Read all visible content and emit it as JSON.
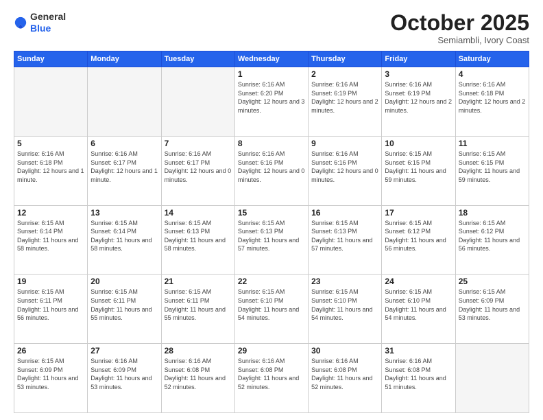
{
  "header": {
    "logo_line1": "General",
    "logo_line2": "Blue",
    "month": "October 2025",
    "location": "Semiambli, Ivory Coast"
  },
  "weekdays": [
    "Sunday",
    "Monday",
    "Tuesday",
    "Wednesday",
    "Thursday",
    "Friday",
    "Saturday"
  ],
  "weeks": [
    [
      {
        "day": "",
        "info": ""
      },
      {
        "day": "",
        "info": ""
      },
      {
        "day": "",
        "info": ""
      },
      {
        "day": "1",
        "info": "Sunrise: 6:16 AM\nSunset: 6:20 PM\nDaylight: 12 hours and 3 minutes."
      },
      {
        "day": "2",
        "info": "Sunrise: 6:16 AM\nSunset: 6:19 PM\nDaylight: 12 hours and 2 minutes."
      },
      {
        "day": "3",
        "info": "Sunrise: 6:16 AM\nSunset: 6:19 PM\nDaylight: 12 hours and 2 minutes."
      },
      {
        "day": "4",
        "info": "Sunrise: 6:16 AM\nSunset: 6:18 PM\nDaylight: 12 hours and 2 minutes."
      }
    ],
    [
      {
        "day": "5",
        "info": "Sunrise: 6:16 AM\nSunset: 6:18 PM\nDaylight: 12 hours and 1 minute."
      },
      {
        "day": "6",
        "info": "Sunrise: 6:16 AM\nSunset: 6:17 PM\nDaylight: 12 hours and 1 minute."
      },
      {
        "day": "7",
        "info": "Sunrise: 6:16 AM\nSunset: 6:17 PM\nDaylight: 12 hours and 0 minutes."
      },
      {
        "day": "8",
        "info": "Sunrise: 6:16 AM\nSunset: 6:16 PM\nDaylight: 12 hours and 0 minutes."
      },
      {
        "day": "9",
        "info": "Sunrise: 6:16 AM\nSunset: 6:16 PM\nDaylight: 12 hours and 0 minutes."
      },
      {
        "day": "10",
        "info": "Sunrise: 6:15 AM\nSunset: 6:15 PM\nDaylight: 11 hours and 59 minutes."
      },
      {
        "day": "11",
        "info": "Sunrise: 6:15 AM\nSunset: 6:15 PM\nDaylight: 11 hours and 59 minutes."
      }
    ],
    [
      {
        "day": "12",
        "info": "Sunrise: 6:15 AM\nSunset: 6:14 PM\nDaylight: 11 hours and 58 minutes."
      },
      {
        "day": "13",
        "info": "Sunrise: 6:15 AM\nSunset: 6:14 PM\nDaylight: 11 hours and 58 minutes."
      },
      {
        "day": "14",
        "info": "Sunrise: 6:15 AM\nSunset: 6:13 PM\nDaylight: 11 hours and 58 minutes."
      },
      {
        "day": "15",
        "info": "Sunrise: 6:15 AM\nSunset: 6:13 PM\nDaylight: 11 hours and 57 minutes."
      },
      {
        "day": "16",
        "info": "Sunrise: 6:15 AM\nSunset: 6:13 PM\nDaylight: 11 hours and 57 minutes."
      },
      {
        "day": "17",
        "info": "Sunrise: 6:15 AM\nSunset: 6:12 PM\nDaylight: 11 hours and 56 minutes."
      },
      {
        "day": "18",
        "info": "Sunrise: 6:15 AM\nSunset: 6:12 PM\nDaylight: 11 hours and 56 minutes."
      }
    ],
    [
      {
        "day": "19",
        "info": "Sunrise: 6:15 AM\nSunset: 6:11 PM\nDaylight: 11 hours and 56 minutes."
      },
      {
        "day": "20",
        "info": "Sunrise: 6:15 AM\nSunset: 6:11 PM\nDaylight: 11 hours and 55 minutes."
      },
      {
        "day": "21",
        "info": "Sunrise: 6:15 AM\nSunset: 6:11 PM\nDaylight: 11 hours and 55 minutes."
      },
      {
        "day": "22",
        "info": "Sunrise: 6:15 AM\nSunset: 6:10 PM\nDaylight: 11 hours and 54 minutes."
      },
      {
        "day": "23",
        "info": "Sunrise: 6:15 AM\nSunset: 6:10 PM\nDaylight: 11 hours and 54 minutes."
      },
      {
        "day": "24",
        "info": "Sunrise: 6:15 AM\nSunset: 6:10 PM\nDaylight: 11 hours and 54 minutes."
      },
      {
        "day": "25",
        "info": "Sunrise: 6:15 AM\nSunset: 6:09 PM\nDaylight: 11 hours and 53 minutes."
      }
    ],
    [
      {
        "day": "26",
        "info": "Sunrise: 6:15 AM\nSunset: 6:09 PM\nDaylight: 11 hours and 53 minutes."
      },
      {
        "day": "27",
        "info": "Sunrise: 6:16 AM\nSunset: 6:09 PM\nDaylight: 11 hours and 53 minutes."
      },
      {
        "day": "28",
        "info": "Sunrise: 6:16 AM\nSunset: 6:08 PM\nDaylight: 11 hours and 52 minutes."
      },
      {
        "day": "29",
        "info": "Sunrise: 6:16 AM\nSunset: 6:08 PM\nDaylight: 11 hours and 52 minutes."
      },
      {
        "day": "30",
        "info": "Sunrise: 6:16 AM\nSunset: 6:08 PM\nDaylight: 11 hours and 52 minutes."
      },
      {
        "day": "31",
        "info": "Sunrise: 6:16 AM\nSunset: 6:08 PM\nDaylight: 11 hours and 51 minutes."
      },
      {
        "day": "",
        "info": ""
      }
    ]
  ]
}
